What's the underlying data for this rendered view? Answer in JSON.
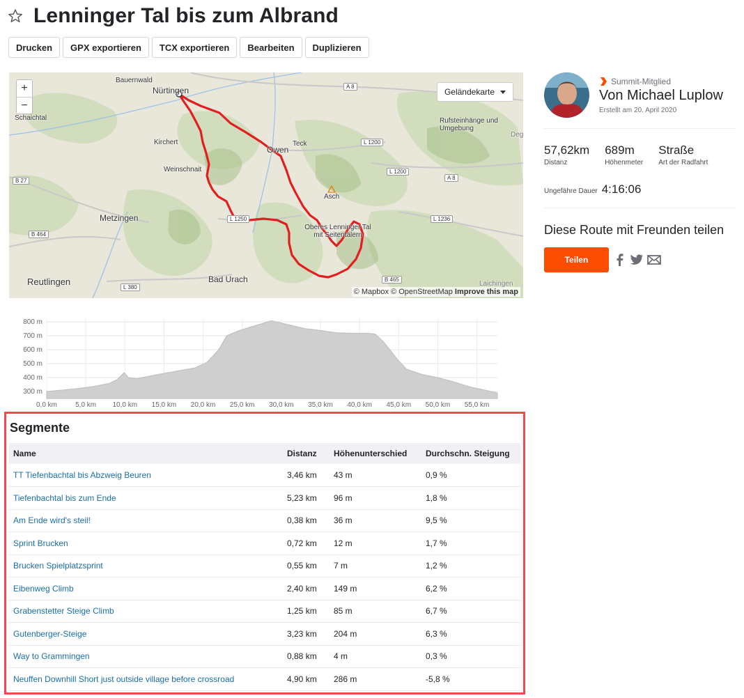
{
  "route": {
    "title": "Lenninger Tal bis zum Albrand"
  },
  "toolbar": {
    "buttons": [
      "Drucken",
      "GPX exportieren",
      "TCX exportieren",
      "Bearbeiten",
      "Duplizieren"
    ]
  },
  "map": {
    "zoom_in": "+",
    "zoom_out": "−",
    "type_selector": "Geländekarte",
    "attribution_mapbox": "© Mapbox",
    "attribution_osm": "© OpenStreetMap",
    "attribution_improve": "Improve this map",
    "places": {
      "bauernwald": "Bauernwald",
      "nuertingen": "Nürtingen",
      "schaichtal": "Schaichtal",
      "kirchert": "Kirchert",
      "weinschnait": "Weinschnait",
      "owen": "Owen",
      "teck": "Teck",
      "asch": "Asch",
      "rufstein": "Rufsteinhänge und Umgebung",
      "metzingen": "Metzingen",
      "oberes_tal": "Oberes Lenninger Tal mit Seitentälern",
      "reutlingen": "Reutlingen",
      "bad_urach": "Bad Urach",
      "laichingen": "Laichingen",
      "deggingen_partial": "Deg"
    },
    "roads": {
      "a8_top": "A 8",
      "a8_right": "A 8",
      "l1200_a": "L 1200",
      "l1200_b": "L 1200",
      "l1236": "L 1236",
      "b465": "B 465",
      "b27": "B 27",
      "b464": "B 464",
      "l380": "L 380",
      "l1250": "L 1250"
    }
  },
  "elevation": {
    "y_ticks": [
      "800 m",
      "700 m",
      "600 m",
      "500 m",
      "400 m",
      "300 m"
    ],
    "x_ticks": [
      "0,0 km",
      "5,0 km",
      "10,0 km",
      "15,0 km",
      "20,0 km",
      "25,0 km",
      "30,0 km",
      "35,0 km",
      "40,0 km",
      "45,0 km",
      "50,0 km",
      "55,0 km"
    ],
    "profile": [
      [
        0,
        300
      ],
      [
        2,
        310
      ],
      [
        4,
        322
      ],
      [
        6,
        336
      ],
      [
        8,
        358
      ],
      [
        9,
        385
      ],
      [
        9.9,
        435
      ],
      [
        10.5,
        398
      ],
      [
        11.5,
        392
      ],
      [
        14,
        420
      ],
      [
        17,
        450
      ],
      [
        19,
        470
      ],
      [
        20.5,
        510
      ],
      [
        22,
        600
      ],
      [
        23,
        700
      ],
      [
        24.5,
        735
      ],
      [
        26,
        762
      ],
      [
        27.5,
        787
      ],
      [
        28.7,
        808
      ],
      [
        29.5,
        798
      ],
      [
        31,
        778
      ],
      [
        33,
        752
      ],
      [
        35,
        738
      ],
      [
        37,
        722
      ],
      [
        39,
        718
      ],
      [
        41,
        718
      ],
      [
        42,
        712
      ],
      [
        43,
        660
      ],
      [
        44,
        590
      ],
      [
        45,
        520
      ],
      [
        46,
        460
      ],
      [
        48,
        422
      ],
      [
        50,
        400
      ],
      [
        52,
        370
      ],
      [
        54,
        335
      ],
      [
        56,
        310
      ],
      [
        57.62,
        290
      ]
    ],
    "y_range": [
      250,
      820
    ],
    "x_range": [
      0,
      57.62
    ]
  },
  "segments": {
    "title": "Segmente",
    "columns": [
      "Name",
      "Distanz",
      "Höhenunterschied",
      "Durchschn. Steigung"
    ],
    "rows": [
      [
        "TT Tiefenbachtal bis Abzweig Beuren",
        "3,46 km",
        "43 m",
        "0,9 %"
      ],
      [
        "Tiefenbachtal bis zum Ende",
        "5,23 km",
        "96 m",
        "1,8 %"
      ],
      [
        "Am Ende wird's steil!",
        "0,38 km",
        "36 m",
        "9,5 %"
      ],
      [
        "Sprint Brucken",
        "0,72 km",
        "12 m",
        "1,7 %"
      ],
      [
        "Brucken Spielplatzsprint",
        "0,55 km",
        "7 m",
        "1,2 %"
      ],
      [
        "Eibenweg Climb",
        "2,40 km",
        "149 m",
        "6,2 %"
      ],
      [
        "Grabenstetter Steige Climb",
        "1,25 km",
        "85 m",
        "6,7 %"
      ],
      [
        "Gutenberger-Steige",
        "3,23 km",
        "204 m",
        "6,3 %"
      ],
      [
        "Way to Grammingen",
        "0,88 km",
        "4 m",
        "0,3 %"
      ],
      [
        "Neuffen Downhill Short just outside village before crossroad",
        "4,90 km",
        "286 m",
        "-5,8 %"
      ]
    ]
  },
  "athlete": {
    "badge": "Summit-Mitglied",
    "name": "Von Michael Luplow",
    "created": "Erstellt am 20. April 2020"
  },
  "stats": {
    "distance_value": "57,62km",
    "distance_label": "Distanz",
    "elevation_value": "689m",
    "elevation_label": "Höhenmeter",
    "type_value": "Straße",
    "type_label": "Art der Radfahrt",
    "duration_label": "Ungefähre Dauer",
    "duration_value": "4:16:06"
  },
  "share": {
    "title": "Diese Route mit Freunden teilen",
    "button": "Teilen",
    "icons": [
      "facebook-icon",
      "twitter-icon",
      "email-icon"
    ]
  },
  "colors": {
    "accent": "#fc4c02",
    "route_line": "#e02020",
    "link": "#1b6ea9",
    "highlight_border": "#f14a4f"
  }
}
